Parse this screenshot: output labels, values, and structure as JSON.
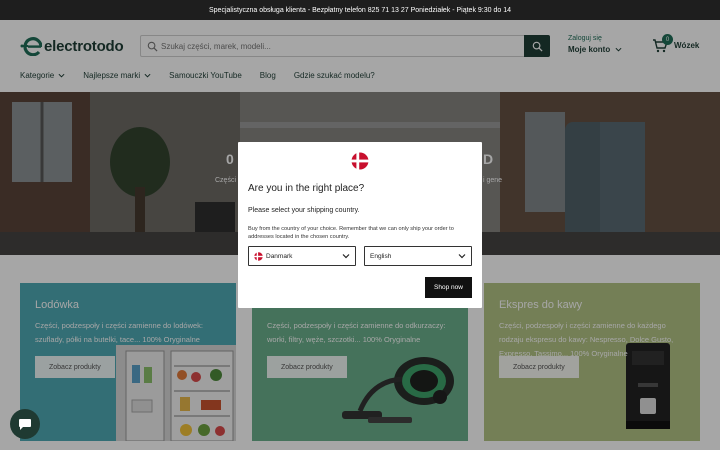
{
  "announcement": "Specjalistyczna obsługa klienta - Bezpłatny telefon 825 71 13 27 Poniedziałek - Piątek 9:30 do 14",
  "brand": {
    "name": "electrotodo",
    "primary_color": "#1f3e36",
    "accent_color": "#1f6e58"
  },
  "search": {
    "placeholder": "Szukaj części, marek, modeli..."
  },
  "account": {
    "login": "Zaloguj się",
    "label": "Moje konto"
  },
  "cart": {
    "count": "0",
    "label": "Wózek"
  },
  "nav": {
    "items": [
      {
        "label": "Kategorie",
        "dropdown": true
      },
      {
        "label": "Najlepsze marki",
        "dropdown": true
      },
      {
        "label": "Samouczki YouTube"
      },
      {
        "label": "Blog"
      },
      {
        "label": "Gdzie szukać modelu?"
      }
    ]
  },
  "hero": {
    "title_fragments": [
      "0",
      "D"
    ],
    "subtitle_fragments": [
      "Części",
      "i gene"
    ]
  },
  "cards": [
    {
      "title": "Lodówka",
      "desc": "Części, podzespoły i części zamienne do lodówek: szuflady, półki na butelki, tace... 100% Oryginalne",
      "button": "Zobacz produkty",
      "color": "#4fa9b4"
    },
    {
      "title": "",
      "desc": "Części, podzespoły i części zamienne do odkurzaczy: worki, filtry, węże, szczotki... 100% Oryginalne",
      "button": "Zobacz produkty",
      "color": "#6ab08c"
    },
    {
      "title": "Ekspres do kawy",
      "desc": "Części, podzespoły i części zamienne do każdego rodzaju ekspresu do kawy: Nespresso, Dolce Gusto, Expresso, Tassimo... 100% Oryginalne",
      "button": "Zobacz produkty",
      "color": "#b3c485"
    }
  ],
  "modal": {
    "title": "Are you in the right place?",
    "subtitle": "Please select your shipping country.",
    "note": "Buy from the country of your choice. Remember that we can only ship your order to addresses located in the chosen country.",
    "country": "Danmark",
    "language": "English",
    "button": "Shop now"
  }
}
